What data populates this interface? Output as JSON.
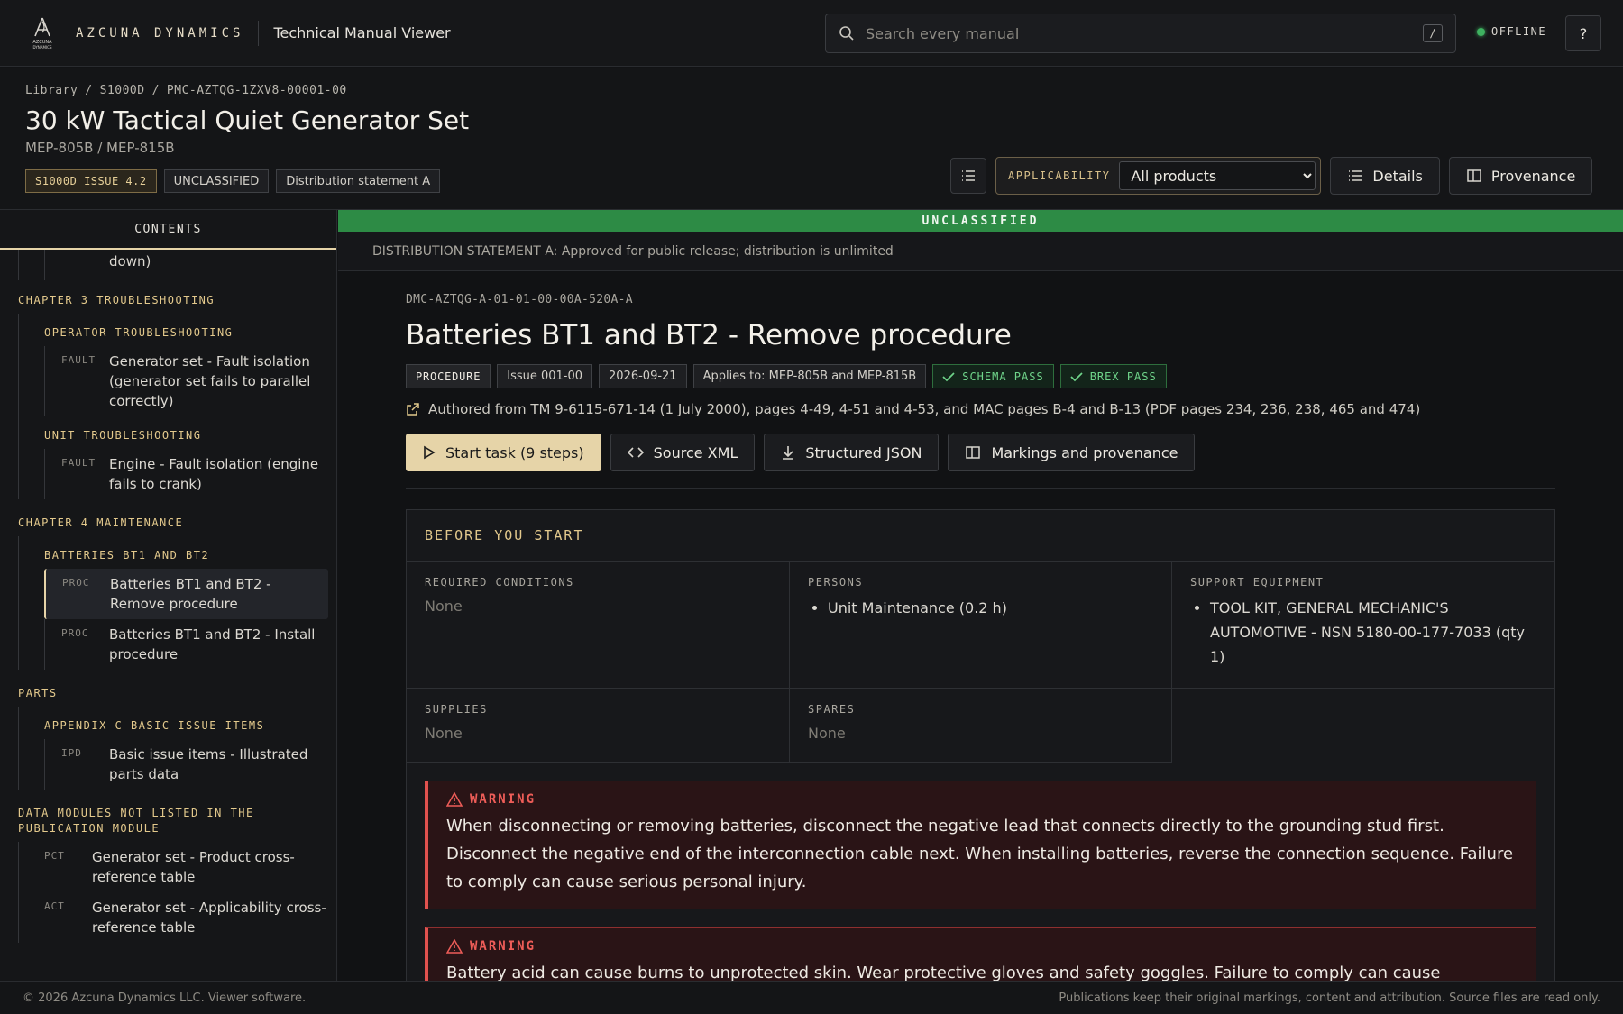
{
  "topbar": {
    "brand": "AZCUNA DYNAMICS",
    "logo_text": "AZCUNA DYNAMICS",
    "app_title": "Technical Manual Viewer",
    "search_placeholder": "Search every manual",
    "search_shortcut": "/",
    "status": "OFFLINE",
    "status_color": "#3eb260",
    "help_label": "?"
  },
  "header": {
    "breadcrumb": [
      "Library",
      "S1000D",
      "PMC-AZTQG-1ZXV8-00001-00"
    ],
    "title": "30 kW Tactical Quiet Generator Set",
    "subtitle": "MEP-805B / MEP-815B",
    "tags": [
      "S1000D ISSUE 4.2",
      "UNCLASSIFIED",
      "Distribution statement A"
    ],
    "applicability_label": "APPLICABILITY",
    "applicability_value": "All products",
    "details_label": "Details",
    "provenance_label": "Provenance"
  },
  "sidebar": {
    "tab": "CONTENTS",
    "clipped_text": "down)",
    "groups": [
      {
        "chapter": "CHAPTER 3 TROUBLESHOOTING",
        "sections": [
          {
            "title": "OPERATOR TROUBLESHOOTING",
            "items": [
              {
                "kind": "FAULT",
                "title": "Generator set - Fault isolation (generator set fails to parallel correctly)"
              }
            ]
          },
          {
            "title": "UNIT TROUBLESHOOTING",
            "items": [
              {
                "kind": "FAULT",
                "title": "Engine - Fault isolation (engine fails to crank)"
              }
            ]
          }
        ]
      },
      {
        "chapter": "CHAPTER 4 MAINTENANCE",
        "sections": [
          {
            "title": "BATTERIES BT1 AND BT2",
            "items": [
              {
                "kind": "PROC",
                "title": "Batteries BT1 and BT2 - Remove procedure",
                "active": true
              },
              {
                "kind": "PROC",
                "title": "Batteries BT1 and BT2 - Install procedure"
              }
            ]
          }
        ]
      },
      {
        "chapter": "PARTS",
        "sections": [
          {
            "title": "APPENDIX C BASIC ISSUE ITEMS",
            "items": [
              {
                "kind": "IPD",
                "title": "Basic issue items - Illustrated parts data"
              }
            ]
          }
        ]
      },
      {
        "chapter": "DATA MODULES NOT LISTED IN THE PUBLICATION MODULE",
        "direct_items": [
          {
            "kind": "PCT",
            "title": "Generator set - Product cross-reference table"
          },
          {
            "kind": "ACT",
            "title": "Generator set - Applicability cross-reference table"
          }
        ]
      }
    ]
  },
  "main": {
    "classification": "UNCLASSIFIED",
    "classification_color": "#2d8b45",
    "distribution": "DISTRIBUTION STATEMENT A: Approved for public release; distribution is unlimited",
    "dmc": "DMC-AZTQG-A-01-01-00-00A-520A-A",
    "title": "Batteries BT1 and BT2 - Remove procedure",
    "tags": {
      "type": "PROCEDURE",
      "issue": "Issue 001-00",
      "date": "2026-09-21",
      "applies": "Applies to: MEP-805B and MEP-815B",
      "schema": "SCHEMA PASS",
      "brex": "BREX PASS"
    },
    "authored": "Authored from TM 9-6115-671-14 (1 July 2000), pages 4-49, 4-51 and 4-53, and MAC pages B-4 and B-13 (PDF pages 234, 236, 238, 465 and 474)",
    "actions": {
      "start": "Start task (9 steps)",
      "source_xml": "Source XML",
      "structured_json": "Structured JSON",
      "markings": "Markings and provenance"
    },
    "before_you_start": {
      "heading": "BEFORE YOU START",
      "required_conditions": {
        "label": "REQUIRED CONDITIONS",
        "value": "None"
      },
      "persons": {
        "label": "PERSONS",
        "items": [
          "Unit Maintenance (0.2 h)"
        ]
      },
      "support_equipment": {
        "label": "SUPPORT EQUIPMENT",
        "items": [
          "TOOL KIT, GENERAL MECHANIC'S AUTOMOTIVE - NSN 5180-00-177-7033 (qty 1)"
        ]
      },
      "supplies": {
        "label": "SUPPLIES",
        "value": "None"
      },
      "spares": {
        "label": "SPARES",
        "value": "None"
      }
    },
    "warnings": [
      {
        "label": "WARNING",
        "text": "When disconnecting or removing batteries, disconnect the negative lead that connects directly to the grounding stud first. Disconnect the negative end of the interconnection cable next. When installing batteries, reverse the connection sequence. Failure to comply can cause serious personal injury."
      },
      {
        "label": "WARNING",
        "text": "Battery acid can cause burns to unprotected skin. Wear protective gloves and safety goggles. Failure to comply can cause"
      }
    ]
  },
  "footer": {
    "left": "© 2026 Azcuna Dynamics LLC. Viewer software.",
    "right": "Publications keep their original markings, content and attribution. Source files are read only."
  }
}
